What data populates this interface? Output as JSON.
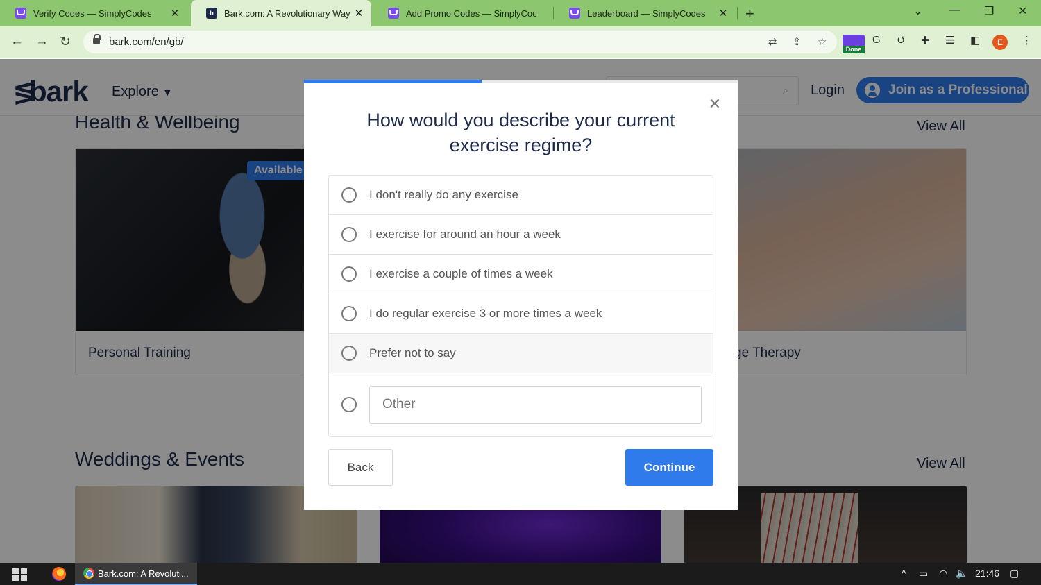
{
  "browser": {
    "tabs": [
      {
        "title": "Verify Codes — SimplyCodes",
        "active": false
      },
      {
        "title": "Bark.com: A Revolutionary Way t",
        "active": true
      },
      {
        "title": "Add Promo Codes — SimplyCoc",
        "active": false
      },
      {
        "title": "Leaderboard — SimplyCodes",
        "active": false
      }
    ],
    "url": "bark.com/en/gb/",
    "extension_badge": "Done",
    "profile_initial": "E"
  },
  "site": {
    "logo": "bark",
    "explore": "Explore",
    "login": "Login",
    "join_button": "Join as a Professional",
    "sections": [
      {
        "title": "Health & Wellbeing",
        "view_all": "View All"
      },
      {
        "title": "Weddings & Events",
        "view_all": "View All"
      }
    ],
    "cards": [
      {
        "caption": "Personal Training",
        "badge": "Available"
      },
      {
        "caption": "ge Therapy"
      }
    ]
  },
  "modal": {
    "progress": 0.41,
    "question": "How would you describe your current exercise regime?",
    "options": [
      "I don't really do any exercise",
      "I exercise for around an hour a week",
      "I exercise a couple of times a week",
      "I do regular exercise 3 or more times a week",
      "Prefer not to say"
    ],
    "other_placeholder": "Other",
    "back_label": "Back",
    "continue_label": "Continue"
  },
  "taskbar": {
    "active_window": "Bark.com: A Revoluti...",
    "clock": "21:46"
  },
  "colors": {
    "accent": "#2f7bec",
    "tabstrip": "#8cc66f",
    "brand_navy": "#1d2a4a"
  }
}
